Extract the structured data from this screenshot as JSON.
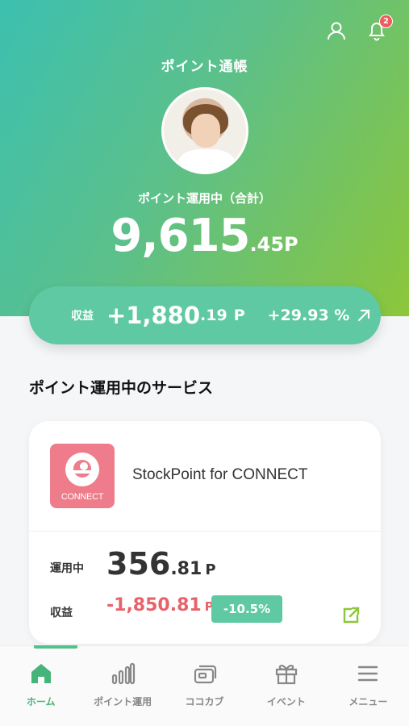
{
  "header": {
    "title": "ポイント通帳",
    "notification_count": "2"
  },
  "summary": {
    "label": "ポイント運用中（合計）",
    "int": "9,615",
    "dec": ".45",
    "unit": "P"
  },
  "profit": {
    "label": "収益",
    "int": "+1,880",
    "dec": ".19",
    "unit": "P",
    "percent": "+29.93 %"
  },
  "services_section": {
    "title": "ポイント運用中のサービス"
  },
  "service_card": {
    "logo_text": "CONNECT",
    "name": "StockPoint for CONNECT",
    "running_label": "運用中",
    "running_int": "356",
    "running_dec": ".81",
    "running_unit": "P",
    "gain_label": "収益",
    "gain_value": "-1,850.81",
    "gain_unit": "P",
    "gain_percent": "-10.5%"
  },
  "tabbar": {
    "items": [
      {
        "label": "ホーム",
        "icon": "home-icon",
        "active": true
      },
      {
        "label": "ポイント運用",
        "icon": "bar-chart-icon",
        "active": false
      },
      {
        "label": "ココカブ",
        "icon": "cards-icon",
        "active": false
      },
      {
        "label": "イベント",
        "icon": "gift-icon",
        "active": false
      },
      {
        "label": "メニュー",
        "icon": "menu-icon",
        "active": false
      }
    ]
  },
  "colors": {
    "accent_green": "#46b478",
    "pill_green": "#5ec9a3",
    "loss_red": "#e8626a",
    "logo_pink": "#ee7c8a"
  }
}
